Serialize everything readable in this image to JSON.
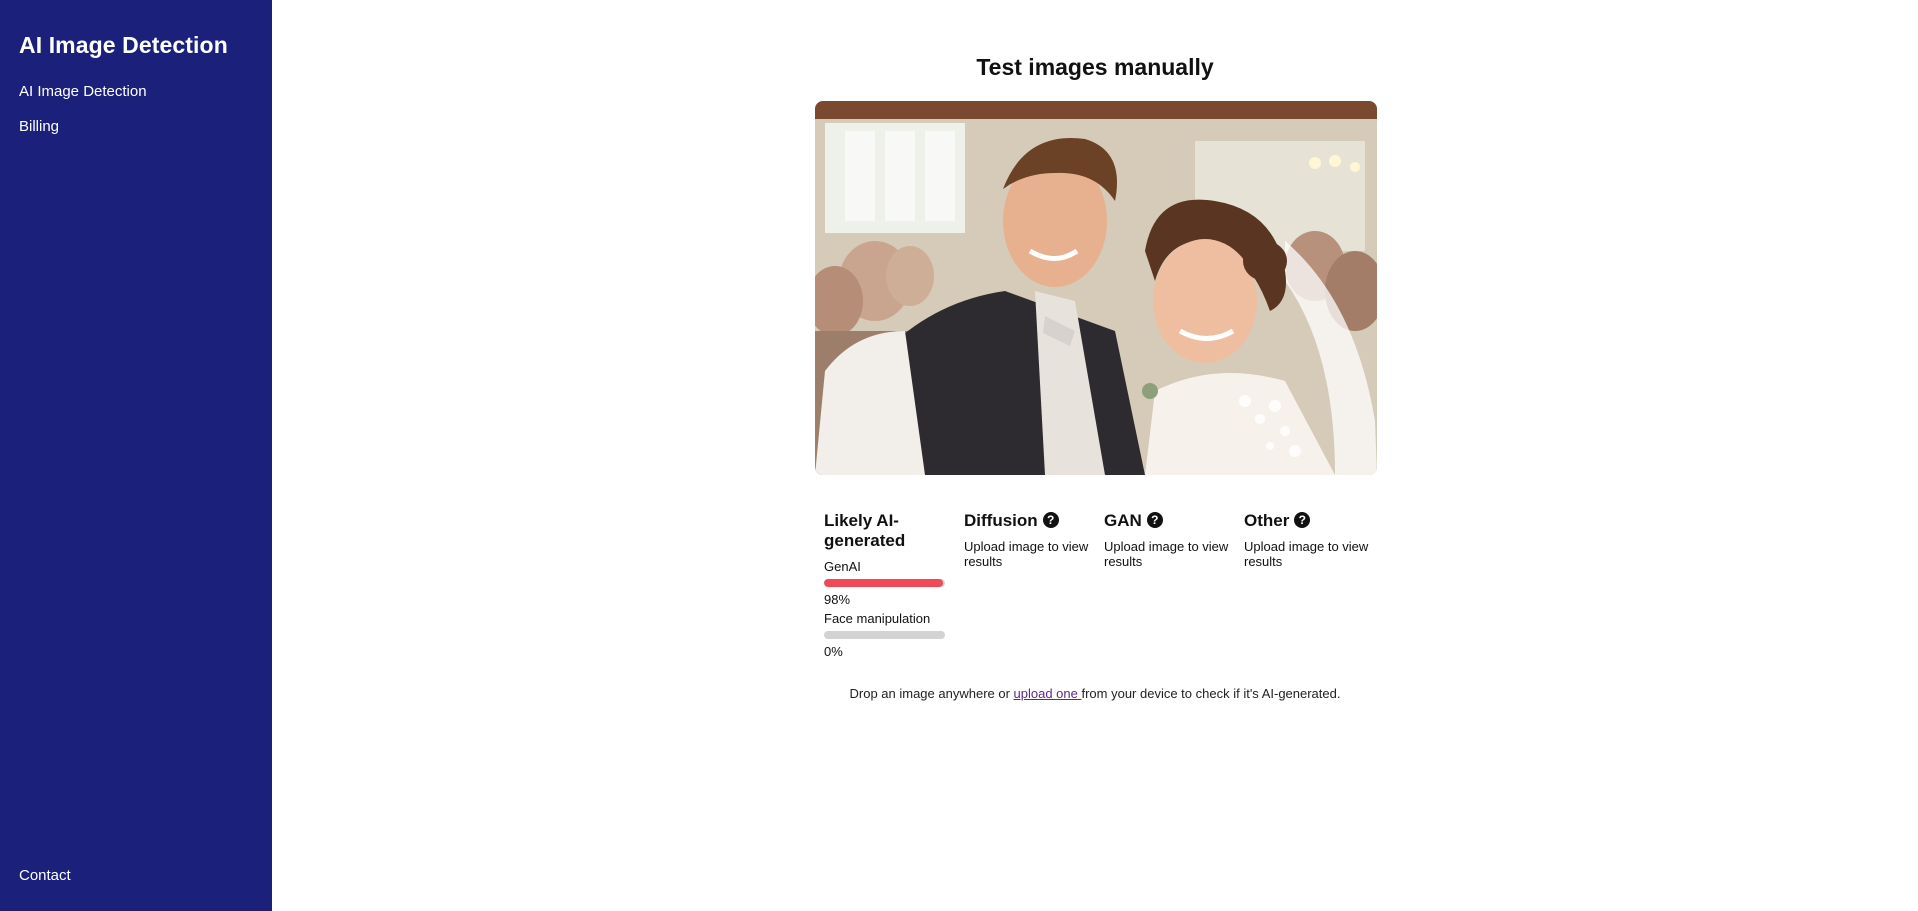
{
  "sidebar": {
    "brand": "AI Image Detection",
    "items": [
      {
        "label": "AI Image Detection"
      },
      {
        "label": "Billing"
      }
    ],
    "footer": {
      "label": "Contact"
    }
  },
  "main": {
    "title": "Test images manually",
    "image_alt": "Photo of a smiling bride and groom at a wedding",
    "results": {
      "likely": {
        "title": "Likely AI-generated",
        "metrics": [
          {
            "label": "GenAI",
            "value": "98%",
            "fraction": 0.98,
            "color": "#f04a56"
          },
          {
            "label": "Face manipulation",
            "value": "0%",
            "fraction": 0.0,
            "color": "#d3d3d3"
          }
        ]
      },
      "diffusion": {
        "title": "Diffusion",
        "text": "Upload image to view results"
      },
      "gan": {
        "title": "GAN",
        "text": "Upload image to view results"
      },
      "other": {
        "title": "Other",
        "text": "Upload image to view results"
      }
    },
    "drop_hint": {
      "before": "Drop an image anywhere or ",
      "link": "upload one ",
      "after": "from your device to check if it's AI-generated."
    }
  },
  "colors": {
    "sidebar_bg": "#1b217a",
    "bar_genai": "#f04a56",
    "bar_track": "#d3d3d3",
    "link": "#5b2a86"
  },
  "icons": {
    "help": "question-circle-icon"
  }
}
